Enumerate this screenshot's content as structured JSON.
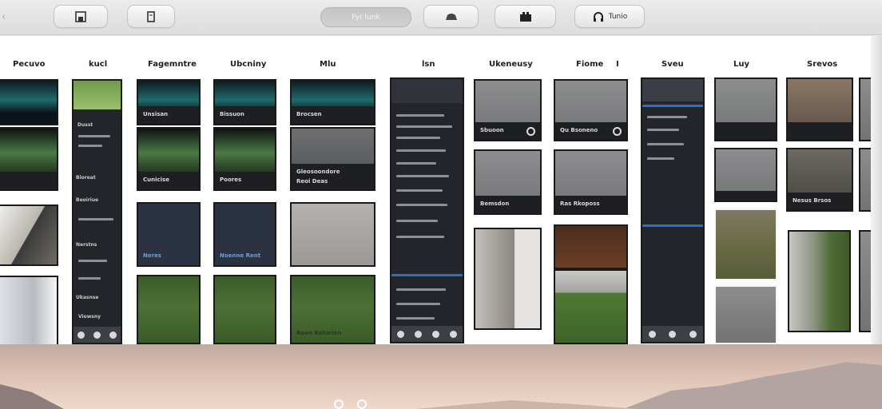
{
  "toolbar": {
    "buttons": [
      {
        "icon": "save-icon",
        "label": ""
      },
      {
        "icon": "edit-icon",
        "label": ""
      },
      {
        "icon": "car-icon",
        "label": ""
      },
      {
        "icon": "photos-icon",
        "label": ""
      },
      {
        "icon": "headphones-icon",
        "label": "Tunio"
      }
    ],
    "search_placeholder": "Fyr lunk"
  },
  "columns": [
    {
      "label": "Pecuvo"
    },
    {
      "label": "kucl"
    },
    {
      "label": "Fagemntre"
    },
    {
      "label": "Ubcniny"
    },
    {
      "label": "Mlu"
    },
    {
      "label": "lsn"
    },
    {
      "label": "Ukeneusy"
    },
    {
      "label": "Fiome"
    },
    {
      "label": "Sveu"
    },
    {
      "label": "Luy"
    },
    {
      "label": "Srevos"
    }
  ],
  "col_extra": "I",
  "captions": {
    "c0a": "",
    "c0b": "",
    "c0d": "",
    "c1a": "Dusst",
    "c1b": "Bioreat",
    "c1c": "Beoiriue",
    "c1d": "Nerstns",
    "c1e": "Ukasnse",
    "c1f": "Viowsny",
    "c2a": "Unsisan",
    "c2b": "Cunicise",
    "c2c": "Neres",
    "c3a": "Bissuon",
    "c3b": "Poores",
    "c3c": "Noenne Rent",
    "c4a": "Brocsen",
    "c4b": "Gleosoondore",
    "c4c": "Reoi Deas",
    "c4d": "Roon Ketorien",
    "c6a": "Sbuoon",
    "c6b": "Bemsdon",
    "c7a": "Qu Bsoneno",
    "c7b": "Ras Rkoposs",
    "c9a": "",
    "c9b": "",
    "c10a": "",
    "c10b": "Nesus Brsos"
  },
  "colors": {
    "accent_blue": "#2f6fc2",
    "tile_border": "#1a1a1a"
  }
}
